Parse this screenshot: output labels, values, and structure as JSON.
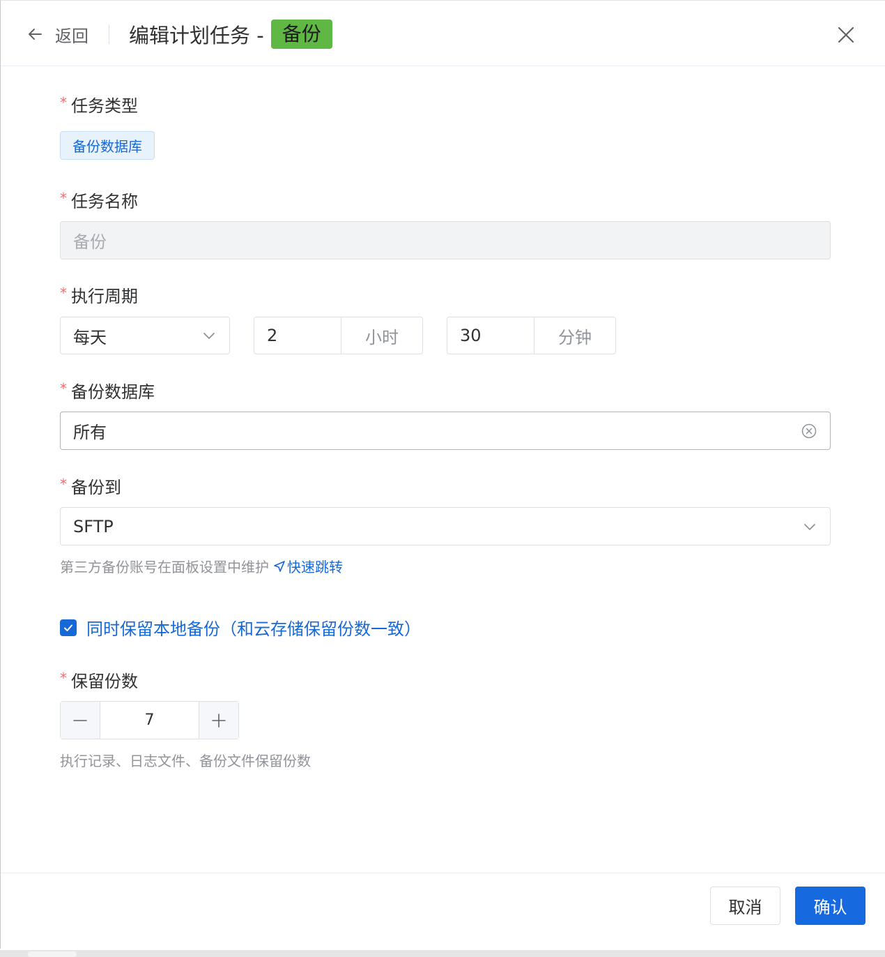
{
  "header": {
    "back_label": "返回",
    "title": "编辑计划任务 -",
    "title_tag": "备份",
    "title_tag_color": "#5fb843"
  },
  "form": {
    "task_type": {
      "label": "任务类型",
      "value": "备份数据库"
    },
    "task_name": {
      "label": "任务名称",
      "value": "备份"
    },
    "cycle": {
      "label": "执行周期",
      "period": "每天",
      "hours": "2",
      "hours_unit": "小时",
      "minutes": "30",
      "minutes_unit": "分钟"
    },
    "database": {
      "label": "备份数据库",
      "value": "所有"
    },
    "backup_to": {
      "label": "备份到",
      "value": "SFTP",
      "hint": "第三方备份账号在面板设置中维护",
      "link": "快速跳转"
    },
    "keep_local": {
      "label": "同时保留本地备份（和云存储保留份数一致）",
      "checked": true
    },
    "retention": {
      "label": "保留份数",
      "value": "7",
      "hint": "执行记录、日志文件、备份文件保留份数"
    }
  },
  "footer": {
    "cancel_label": "取消",
    "confirm_label": "确认"
  },
  "colors": {
    "primary": "#1769e0",
    "required": "#f56c6c",
    "tag_green": "#5fb843"
  },
  "icons": [
    "arrow-left-icon",
    "close-icon",
    "chevron-down-icon",
    "circle-close-icon",
    "send-icon",
    "check-icon",
    "minus-icon",
    "plus-icon"
  ]
}
